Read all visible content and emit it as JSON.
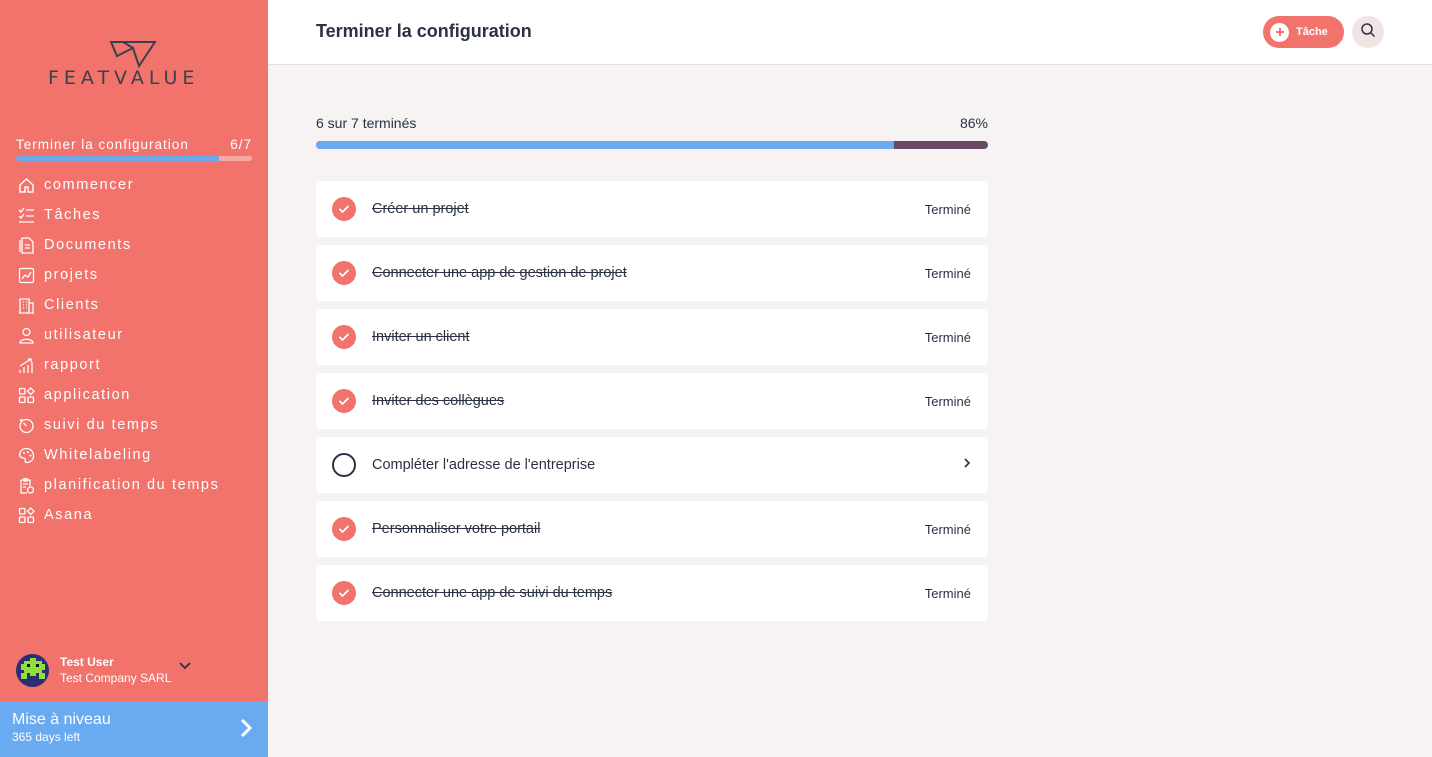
{
  "brand": {
    "name": "FEATVALUE"
  },
  "sidebar": {
    "setup_label": "Terminer la configuration",
    "setup_count": "6/7",
    "setup_progress": 0.86,
    "items": [
      {
        "label": "commencer",
        "icon": "home-icon"
      },
      {
        "label": "Tâches",
        "icon": "tasks-icon"
      },
      {
        "label": "Documents",
        "icon": "documents-icon"
      },
      {
        "label": "projets",
        "icon": "projects-icon"
      },
      {
        "label": "Clients",
        "icon": "clients-icon"
      },
      {
        "label": "utilisateur",
        "icon": "user-icon"
      },
      {
        "label": "rapport",
        "icon": "report-icon"
      },
      {
        "label": "application",
        "icon": "apps-icon"
      },
      {
        "label": "suivi du temps",
        "icon": "timer-icon"
      },
      {
        "label": "Whitelabeling",
        "icon": "palette-icon"
      },
      {
        "label": "planification du temps",
        "icon": "schedule-icon"
      },
      {
        "label": "Asana",
        "icon": "asana-icon"
      }
    ],
    "user": {
      "name": "Test User",
      "company": "Test Company SARL"
    },
    "upgrade": {
      "title": "Mise à niveau",
      "subtitle": "365 days left"
    }
  },
  "header": {
    "title": "Terminer la configuration",
    "task_button": "Tâche"
  },
  "progress": {
    "label": "6 sur 7 terminés",
    "percent_label": "86%",
    "value": 0.86
  },
  "tasks": [
    {
      "title": "Créer un projet",
      "status": "Terminé",
      "done": true
    },
    {
      "title": "Connecter une app de gestion de projet",
      "status": "Terminé",
      "done": true
    },
    {
      "title": "Inviter un client",
      "status": "Terminé",
      "done": true
    },
    {
      "title": "Inviter des collègues",
      "status": "Terminé",
      "done": true
    },
    {
      "title": "Compléter l'adresse de l'entreprise",
      "status": "",
      "done": false
    },
    {
      "title": "Personnaliser votre portail",
      "status": "Terminé",
      "done": true
    },
    {
      "title": "Connecter une app de suivi du temps",
      "status": "Terminé",
      "done": true
    }
  ],
  "colors": {
    "accent": "#f1736b",
    "blue": "#6aaaf0",
    "dark": "#2b3245",
    "track": "#6b4a66"
  }
}
